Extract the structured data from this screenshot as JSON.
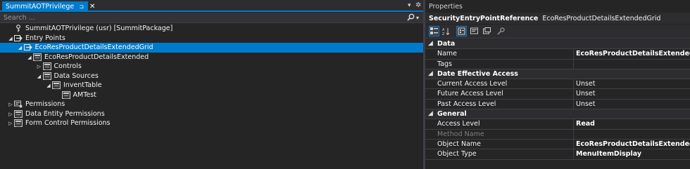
{
  "left_pane": {
    "tab": {
      "title": "SummitAOTPrivilege",
      "pin": "⊐",
      "close": "✕"
    },
    "tab_dropdown": "▾",
    "tab_gear": "✲",
    "search": {
      "placeholder": "Search ...",
      "value": "",
      "icon": "search-icon",
      "dropdown": "▾"
    },
    "tree": [
      {
        "label": "SummitAOTPrivilege (usr) [SummitPackage]",
        "icon": "key-icon",
        "expander": ""
      },
      {
        "label": "Entry Points",
        "icon": "entry-points-icon",
        "expander": "◢"
      },
      {
        "label": "EcoResProductDetailsExtendedGrid",
        "icon": "entry-point-icon",
        "expander": "◢",
        "selected": true
      },
      {
        "label": "EcoResProductDetailsExtended",
        "icon": "form-icon",
        "expander": "◢"
      },
      {
        "label": "Controls",
        "icon": "form-icon",
        "expander": "▷"
      },
      {
        "label": "Data Sources",
        "icon": "form-icon",
        "expander": "◢"
      },
      {
        "label": "InventTable",
        "icon": "form-icon",
        "expander": "◢"
      },
      {
        "label": "AMTest",
        "icon": "form-icon",
        "expander": ""
      },
      {
        "label": "Permissions",
        "icon": "permissions-icon",
        "expander": "▷"
      },
      {
        "label": "Data Entity Permissions",
        "icon": "form-icon",
        "expander": "▷"
      },
      {
        "label": "Form Control Permissions",
        "icon": "form-icon",
        "expander": "▷"
      }
    ]
  },
  "properties": {
    "title": "Properties",
    "object_type": "SecurityEntryPointReference",
    "object_name": "EcoResProductDetailsExtendedGrid",
    "toolbar": [
      "categorized-icon",
      "alphabetical-icon",
      "properties-icon",
      "events-icon",
      "property-pages-icon",
      "wrench-icon"
    ],
    "categories": [
      {
        "name": "Data",
        "toggle": "◢",
        "rows": [
          {
            "key": "Name",
            "value": "EcoResProductDetailsExtendedGrid",
            "bold": true
          },
          {
            "key": "Tags",
            "value": ""
          }
        ]
      },
      {
        "name": "Date Effective Access",
        "toggle": "◢",
        "rows": [
          {
            "key": "Current Access Level",
            "value": "Unset"
          },
          {
            "key": "Future Access Level",
            "value": "Unset"
          },
          {
            "key": "Past Access Level",
            "value": "Unset"
          }
        ]
      },
      {
        "name": "General",
        "toggle": "◢",
        "rows": [
          {
            "key": "Access Level",
            "value": "Read",
            "bold": true
          },
          {
            "key": "Method Name",
            "value": "",
            "dim": true
          },
          {
            "key": "Object Name",
            "value": "EcoResProductDetailsExtendedGrid",
            "bold": true
          },
          {
            "key": "Object Type",
            "value": "MenuItemDisplay",
            "bold": true
          }
        ]
      }
    ]
  },
  "colors": {
    "accent": "#007acc",
    "background": "#252526",
    "chrome": "#2d2d30",
    "text": "#f1f1f1"
  }
}
